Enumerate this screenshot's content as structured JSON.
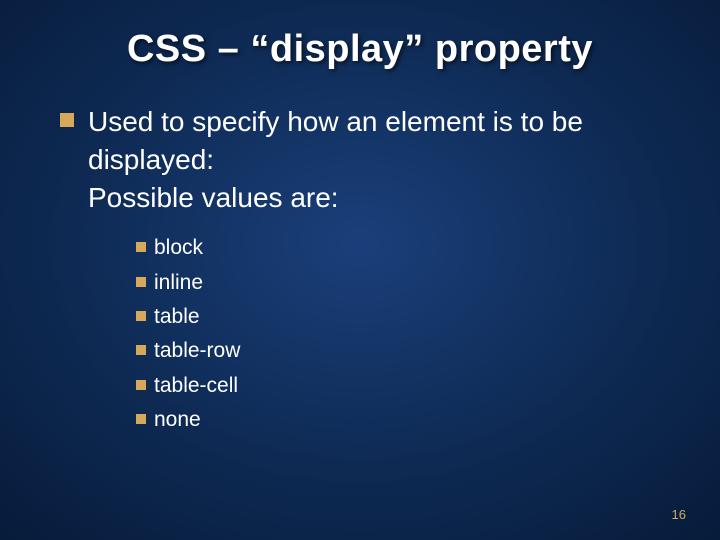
{
  "title": "CSS – “display” property",
  "main_bullet": "Used to specify how an element is to be displayed:\nPossible values are:",
  "values": [
    "block",
    "inline",
    "table",
    "table-row",
    "table-cell",
    "none"
  ],
  "page_number": "16",
  "colors": {
    "bullet": "#d7a85a",
    "text": "#ffffff"
  }
}
